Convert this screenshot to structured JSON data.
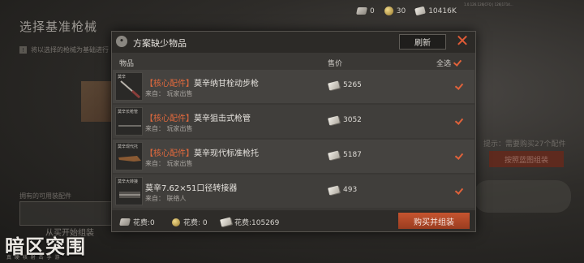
{
  "background": {
    "page_title": "选择基准枪械",
    "hint_text": "将以选择的枪械为基础进行",
    "owned_parts_label": "拥有的可用装配件",
    "left_button_label": "从买开始组装",
    "right_tip": "提示：需要购买27个配件",
    "right_button_label": "按照蓝图组装"
  },
  "logo": {
    "title": "暗区突围",
    "subtitle": "真 硬 核 射 击 手 游"
  },
  "currency_bar": {
    "cards": "0",
    "coins": "30",
    "bills": "10416K"
  },
  "top_info": "1.0.126.126|CFQ | 126|1714...",
  "modal": {
    "title": "方案缺少物品",
    "refresh_label": "刷新",
    "close_label": "✕",
    "col_item": "物品",
    "col_price": "售价",
    "select_all_label": "全选",
    "rows": [
      {
        "thumb_label": "莫辛",
        "tag": "【核心配件】",
        "name": "莫辛纳甘栓动步枪",
        "source": "来自：  玩家出售",
        "price": "5265",
        "checked": true
      },
      {
        "thumb_label": "莫辛长枪管",
        "tag": "【核心配件】",
        "name": "莫辛狙击式枪管",
        "source": "来自：  玩家出售",
        "price": "3052",
        "checked": true
      },
      {
        "thumb_label": "莫辛现代托",
        "tag": "【核心配件】",
        "name": "莫辛现代标准枪托",
        "source": "来自：  玩家出售",
        "price": "5187",
        "checked": true
      },
      {
        "thumb_label": "莫辛大转接",
        "tag": "",
        "name": "莫辛7.62×51口径转接器",
        "source": "来自：  联络人",
        "price": "493",
        "checked": true
      }
    ],
    "footer": {
      "fee_cards": "花费:0",
      "fee_coins": "花费: 0",
      "fee_bills": "花费:105269",
      "buy_label": "购买并组装"
    }
  },
  "colors": {
    "accent": "#e0623a",
    "button_orange": "#b5492a",
    "panel": "#3a3835"
  },
  "icons": [
    "card-icon",
    "coin-icon",
    "bill-icon",
    "checkmark-icon",
    "close-icon"
  ]
}
